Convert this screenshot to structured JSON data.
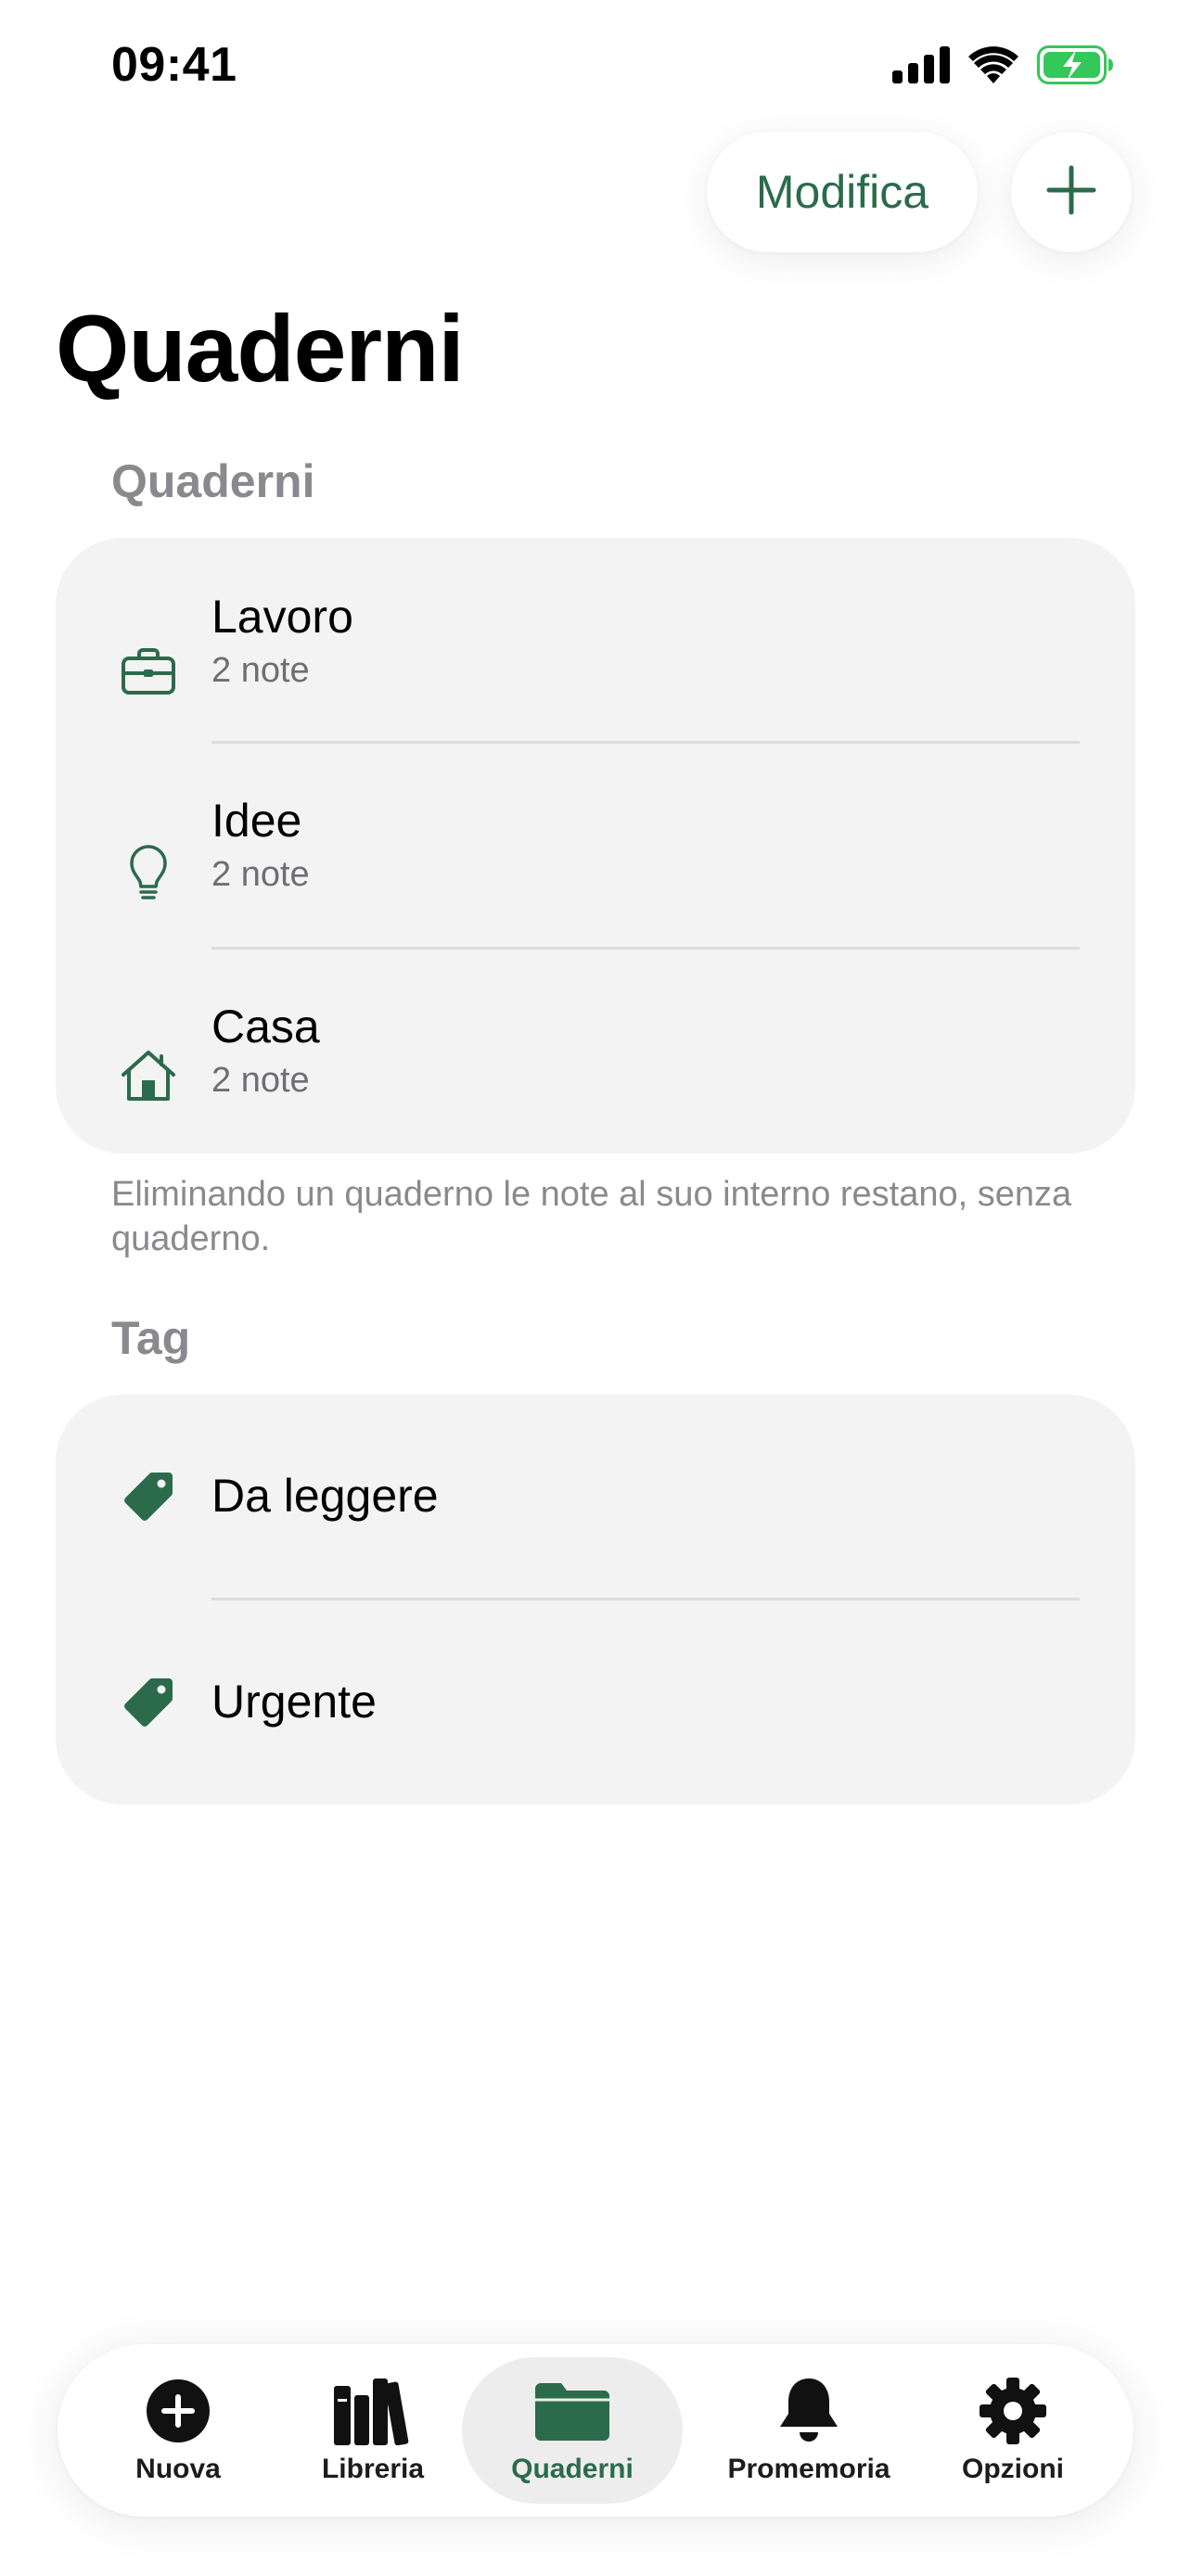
{
  "status_bar": {
    "time": "09:41"
  },
  "header": {
    "edit_label": "Modifica",
    "add_icon": "plus-icon",
    "title": "Quaderni"
  },
  "notebooks_section": {
    "header": "Quaderni",
    "items": [
      {
        "title": "Lavoro",
        "count": "2 note",
        "icon": "briefcase-icon"
      },
      {
        "title": "Idee",
        "count": "2 note",
        "icon": "lightbulb-icon"
      },
      {
        "title": "Casa",
        "count": "2 note",
        "icon": "house-icon"
      }
    ],
    "footnote": "Eliminando un quaderno le note al suo interno restano, senza quaderno."
  },
  "tags_section": {
    "header": "Tag",
    "items": [
      {
        "title": "Da leggere",
        "icon": "tag-icon"
      },
      {
        "title": "Urgente",
        "icon": "tag-icon"
      }
    ]
  },
  "tab_bar": {
    "tabs": [
      {
        "label": "Nuova",
        "icon": "plus-circle-icon",
        "active": false
      },
      {
        "label": "Libreria",
        "icon": "books-icon",
        "active": false
      },
      {
        "label": "Quaderni",
        "icon": "folder-icon",
        "active": true
      },
      {
        "label": "Promemoria",
        "icon": "bell-icon",
        "active": false
      },
      {
        "label": "Opzioni",
        "icon": "gear-icon",
        "active": false
      }
    ]
  },
  "colors": {
    "accent": "#2b6b4c",
    "card_background": "#f3f3f3",
    "secondary_text": "#8a8a8e",
    "battery_green": "#34c759"
  }
}
